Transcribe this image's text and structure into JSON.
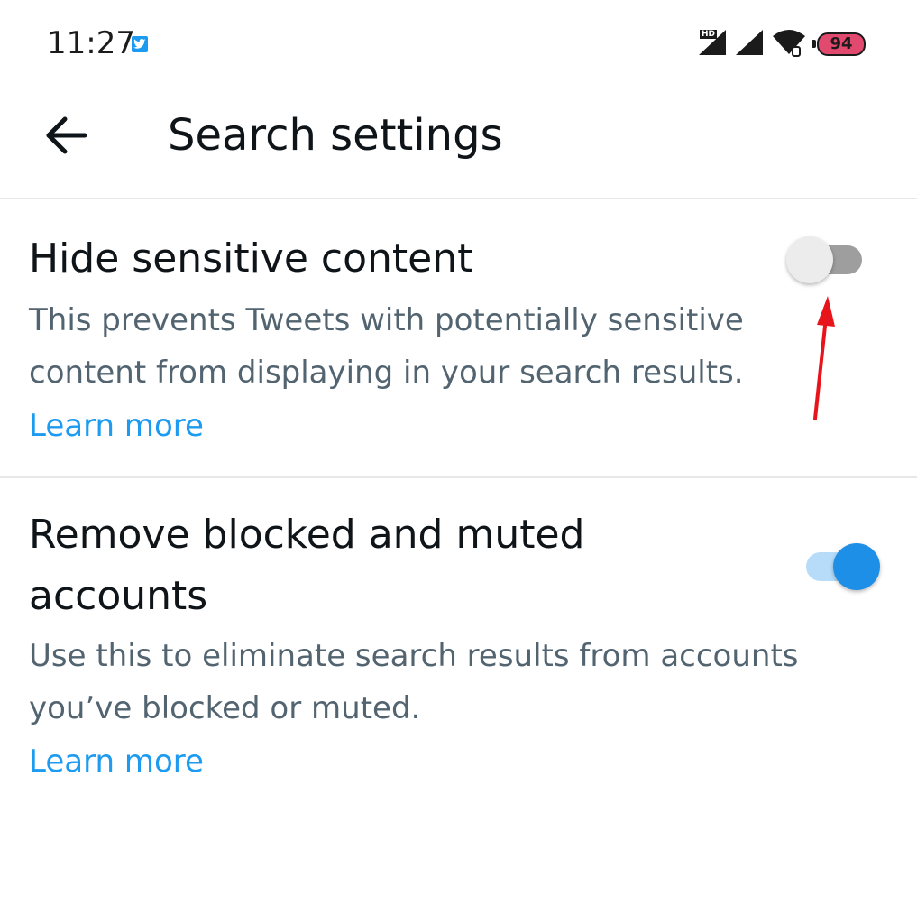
{
  "status_bar": {
    "time": "11:27",
    "battery_level": "94",
    "icons": [
      "twitter-notification-icon",
      "signal-hd-icon",
      "signal-icon",
      "wifi-icon",
      "battery-icon"
    ]
  },
  "header": {
    "title": "Search settings",
    "back_icon": "arrow-left-icon"
  },
  "settings": [
    {
      "title": "Hide sensitive content",
      "description_lines": [
        "This prevents Tweets with potentially sensitive",
        "content from displaying in your search results."
      ],
      "learn_more": "Learn more",
      "enabled": false
    },
    {
      "title_lines": [
        "Remove blocked and muted",
        "accounts"
      ],
      "description_lines": [
        "Use this to eliminate search results from accounts",
        "you’ve blocked or muted."
      ],
      "learn_more": "Learn more",
      "enabled": true
    }
  ],
  "colors": {
    "accent": "#1d9bf0",
    "secondary_text": "#536471",
    "annotation": "#e8141b",
    "battery_fill": "#e14a6e"
  }
}
